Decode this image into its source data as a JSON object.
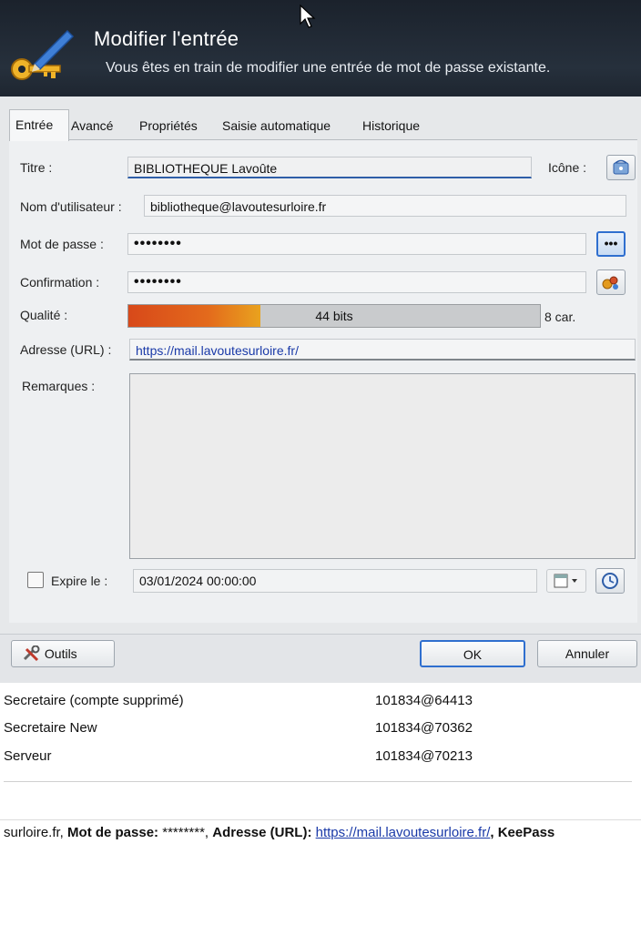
{
  "dialog": {
    "title": "Modifier l'entrée",
    "subtitle": "Vous êtes en train de modifier une entrée de mot de passe existante.",
    "tabs": [
      {
        "label": "Entrée",
        "active": true
      },
      {
        "label": "Avancé"
      },
      {
        "label": "Propriétés"
      },
      {
        "label": "Saisie automatique"
      },
      {
        "label": "Historique"
      }
    ],
    "fields": {
      "title_label": "Titre :",
      "title_value": "BIBLIOTHEQUE Lavoûte",
      "icon_label": "Icône :",
      "username_label": "Nom d'utilisateur :",
      "username_value": "bibliotheque@lavoutesurloire.fr",
      "password_label": "Mot de passe :",
      "password_value": "••••••••",
      "confirm_label": "Confirmation :",
      "confirm_value": "••••••••",
      "quality_label": "Qualité :",
      "quality_text": "44 bits",
      "quality_fraction": 0.32,
      "char_count": "8 car.",
      "url_label": "Adresse (URL) :",
      "url_value": "https://mail.lavoutesurloire.fr/",
      "notes_label": "Remarques :",
      "expire_label": "Expire le :",
      "expire_value": "03/01/2024 00:00:00",
      "expire_checked": false
    },
    "buttons": {
      "tools": "Outils",
      "ok": "OK",
      "cancel": "Annuler",
      "show_password": "•••"
    }
  },
  "background": {
    "rows": [
      {
        "name": "Secretaire (compte supprimé)",
        "user": "101834@64413"
      },
      {
        "name": "Secretaire New",
        "user": "101834@70362"
      },
      {
        "name": "Serveur",
        "user": "101834@70213"
      }
    ],
    "status": {
      "part1": "surloire.fr, ",
      "pw_label": "Mot de passe:",
      "pw_value": " ********, ",
      "url_label": "Adresse (URL):",
      "url_value": "https://mail.lavoutesurloire.fr/",
      "tail": ", KeePass"
    }
  },
  "colors": {
    "titlebar": "#1e2630",
    "link": "#1a3aa8",
    "quality_low": "#d8491a",
    "quality_high": "#e9a21e"
  }
}
